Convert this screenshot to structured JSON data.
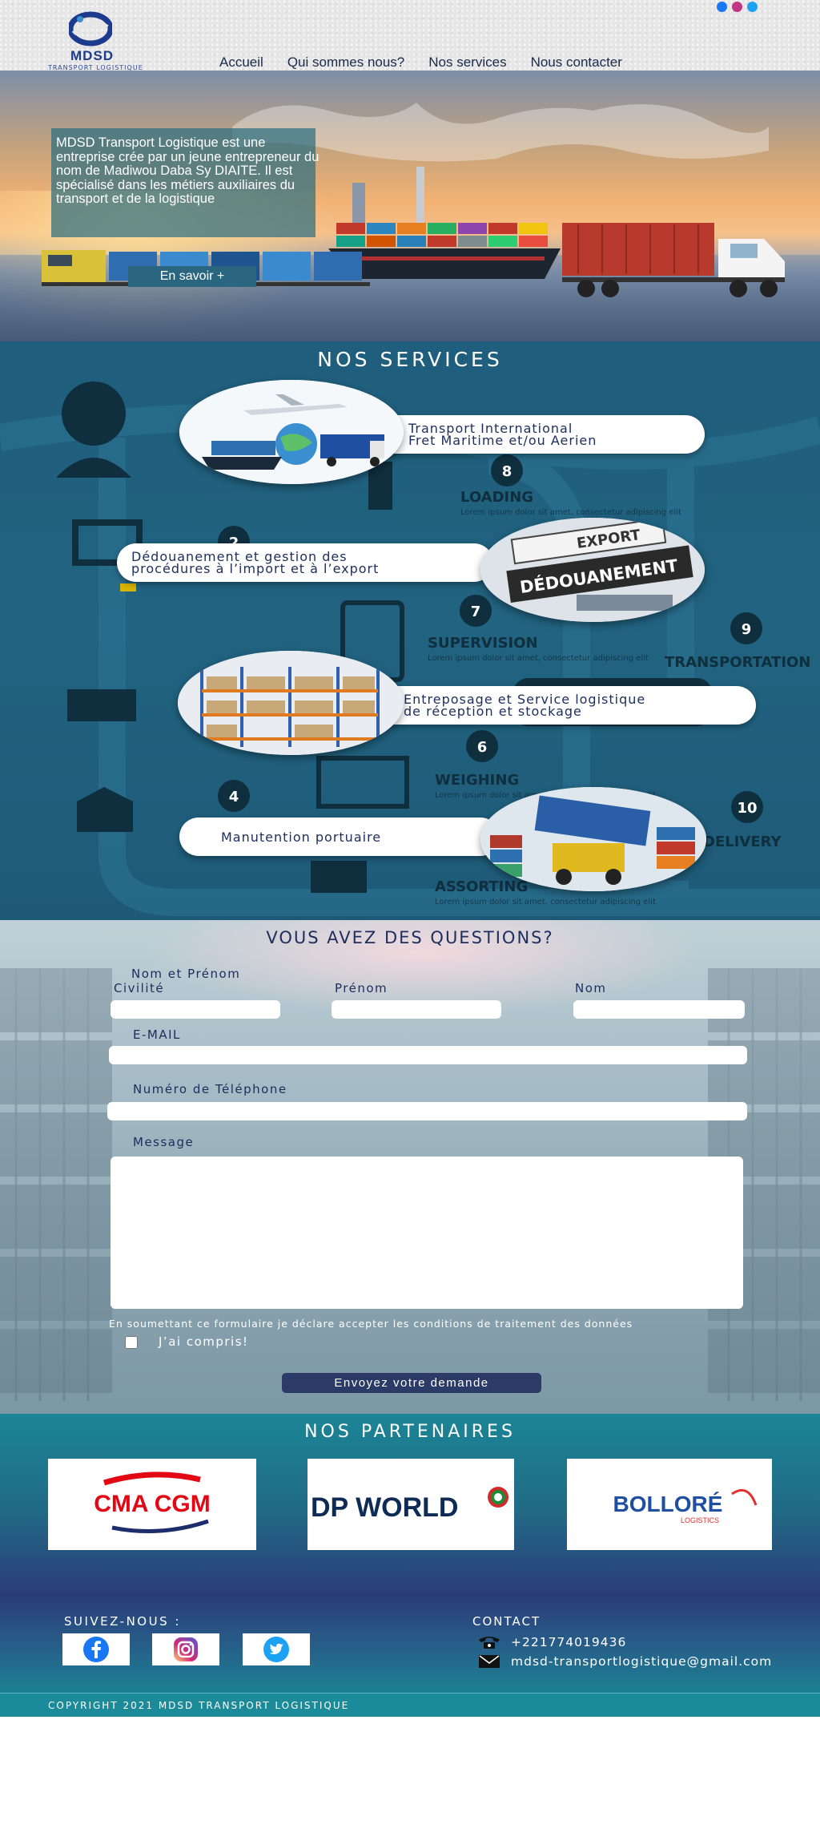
{
  "header": {
    "logo_name": "MDSD",
    "logo_tagline": "TRANSPORT LOGISTIQUE",
    "nav": [
      "Accueil",
      "Qui sommes nous?",
      "Nos services",
      "Nous contacter"
    ]
  },
  "hero": {
    "text": "MDSD Transport Logistique est une entreprise crée par un jeune entrepreneur du nom de Madiwou Daba Sy DIAITE. Il est spécialisé dans les métiers auxiliaires du transport et de la logistique",
    "button": "En savoir +"
  },
  "services": {
    "title": "NOS SERVICES",
    "items": [
      {
        "label_line1": "Transport International",
        "label_line2": "Fret Maritime et/ou Aerien"
      },
      {
        "label_line1": "Dédouanement et gestion des",
        "label_line2": "procédures à l’import et à l’export"
      },
      {
        "label_line1": "Entreposage et Service logistique",
        "label_line2": "de réception et stockage"
      },
      {
        "label_line1": "Manutention portuaire",
        "label_line2": ""
      }
    ],
    "background_labels": [
      {
        "num": "8",
        "word": "LOADING"
      },
      {
        "num": "7",
        "word": "SUPERVISION"
      },
      {
        "num": "9",
        "word": "TRANSPORTATION"
      },
      {
        "num": "6",
        "word": "WEIGHING"
      },
      {
        "num": "10",
        "word": "DELIVERY"
      },
      {
        "num": "",
        "word": "ASSORTING"
      },
      {
        "num": "2",
        "word": ""
      },
      {
        "num": "4",
        "word": ""
      }
    ],
    "lorem": "Lorem ipsum dolor sit amet, consectetur adipiscing elit",
    "bubble_labels": {
      "export": "EXPORT",
      "customs": "DÉDOUANEMENT"
    }
  },
  "contact_form": {
    "title": "VOUS AVEZ DES QUESTIONS?",
    "name_group_label": "Nom et Prénom",
    "civility_label": "Civilité",
    "firstname_label": "Prénom",
    "lastname_label": "Nom",
    "email_label": "E-MAIL",
    "phone_label": "Numéro de Téléphone",
    "message_label": "Message",
    "consent_text": "En soumettant ce formulaire je déclare accepter les conditions de traitement des données",
    "checkbox_label": "J’ai compris!",
    "submit": "Envoyez votre demande"
  },
  "partners": {
    "title": "NOS PARTENAIRES",
    "items": [
      {
        "name": "CMA CGM"
      },
      {
        "name": "DP WORLD"
      },
      {
        "name": "BOLLORÉ",
        "sub": "LOGISTICS"
      }
    ]
  },
  "follow": {
    "title": "SUIVEZ-NOUS :",
    "networks": [
      "facebook-icon",
      "instagram-icon",
      "twitter-icon"
    ]
  },
  "contact_info": {
    "title": "CONTACT",
    "phone": "+221774019436",
    "email": "mdsd-transportlogistique@gmail.com"
  },
  "footer": {
    "copyright": "COPYRIGHT 2021 MDSD TRANSPORT LOGISTIQUE"
  },
  "colors": {
    "brand_blue": "#1d3b8c",
    "teal": "#1b8a99",
    "navy_button": "#2c3a68",
    "services_bg": "#216380"
  }
}
